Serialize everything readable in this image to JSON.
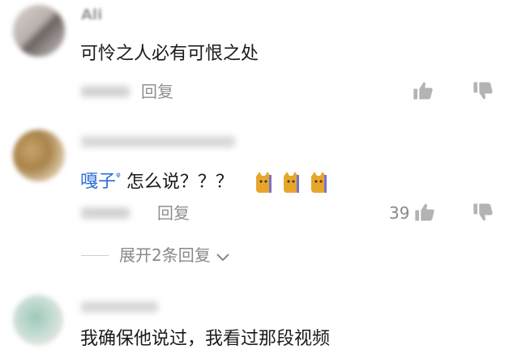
{
  "comments": [
    {
      "author_partial": "Ali",
      "text": "可怜之人必有可恨之处",
      "reply_label": "回复"
    },
    {
      "mention": "嘎子",
      "mention_mark": "ᵠ",
      "text": "怎么说？？？",
      "reply_label": "回复",
      "likes": "39",
      "expand_label": "展开2条回复"
    },
    {
      "text": "我确保他说过，我看过那段视频"
    }
  ],
  "icons": [
    "thumbs-up-icon",
    "thumbs-down-icon",
    "chevron-down-icon",
    "cat-emoji"
  ],
  "colors": {
    "mention": "#2c6bd6",
    "meta": "#8f8f8f",
    "text": "#1a1a1a"
  }
}
